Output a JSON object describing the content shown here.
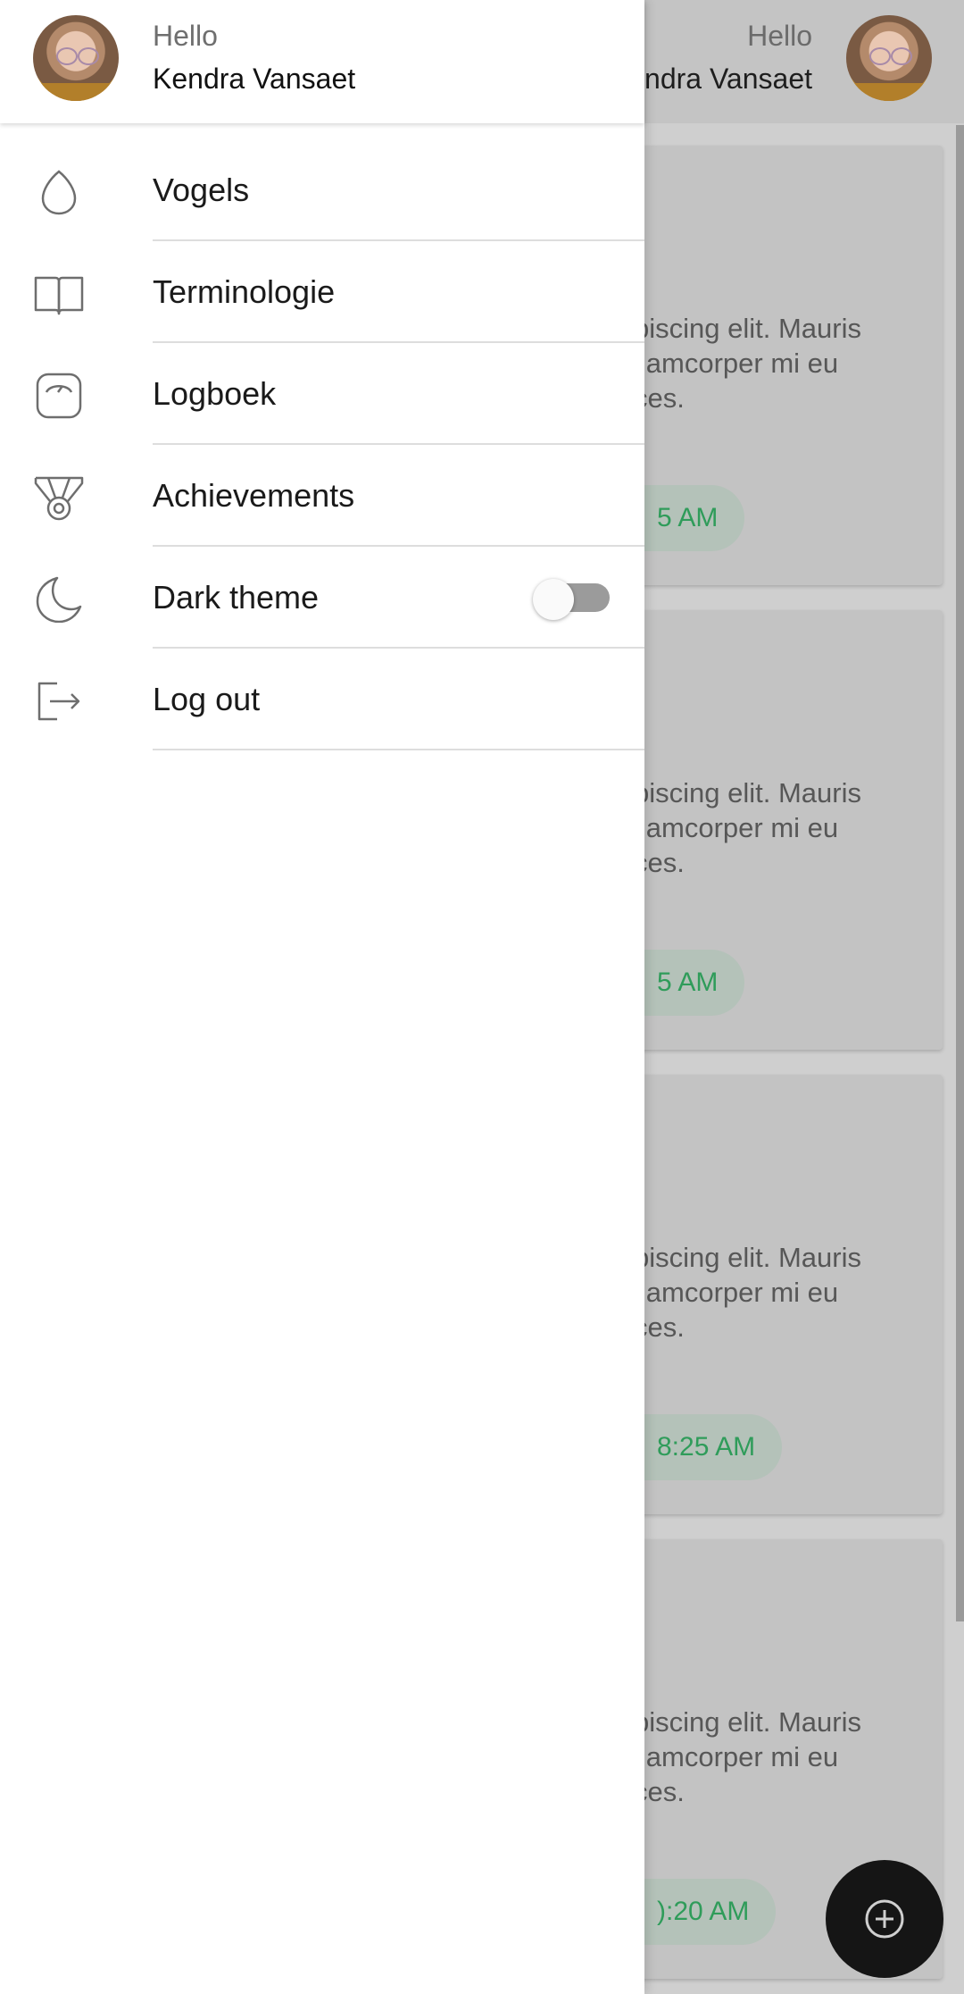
{
  "user": {
    "greeting": "Hello",
    "name": "Kendra Vansaet",
    "background_name_visible": "ndra Vansaet"
  },
  "drawer": {
    "items": [
      {
        "label": "Vogels",
        "icon": "egg-icon"
      },
      {
        "label": "Terminologie",
        "icon": "book-icon"
      },
      {
        "label": "Logboek",
        "icon": "scale-icon"
      },
      {
        "label": "Achievements",
        "icon": "medal-icon"
      },
      {
        "label": "Dark theme",
        "icon": "moon-icon",
        "toggle": false
      },
      {
        "label": "Log out",
        "icon": "logout-icon"
      }
    ]
  },
  "background": {
    "cards": [
      {
        "line1": "biscing elit. Mauris",
        "line2": "llamcorper mi eu",
        "line3": "ces.",
        "time": "5 AM"
      },
      {
        "line1": "biscing elit. Mauris",
        "line2": "llamcorper mi eu",
        "line3": "ces.",
        "time": "5 AM"
      },
      {
        "line1": "biscing elit. Mauris",
        "line2": "llamcorper mi eu",
        "line3": "ces.",
        "time": "8:25 AM"
      },
      {
        "line1": "biscing elit. Mauris",
        "line2": "llamcorper mi eu",
        "line3": "ces.",
        "time": "):20 AM"
      }
    ],
    "fab_icon": "add-circle-icon"
  },
  "colors": {
    "accent_green": "#2f9c5a",
    "scrim": "#cfcfcf",
    "fab": "#151515"
  }
}
